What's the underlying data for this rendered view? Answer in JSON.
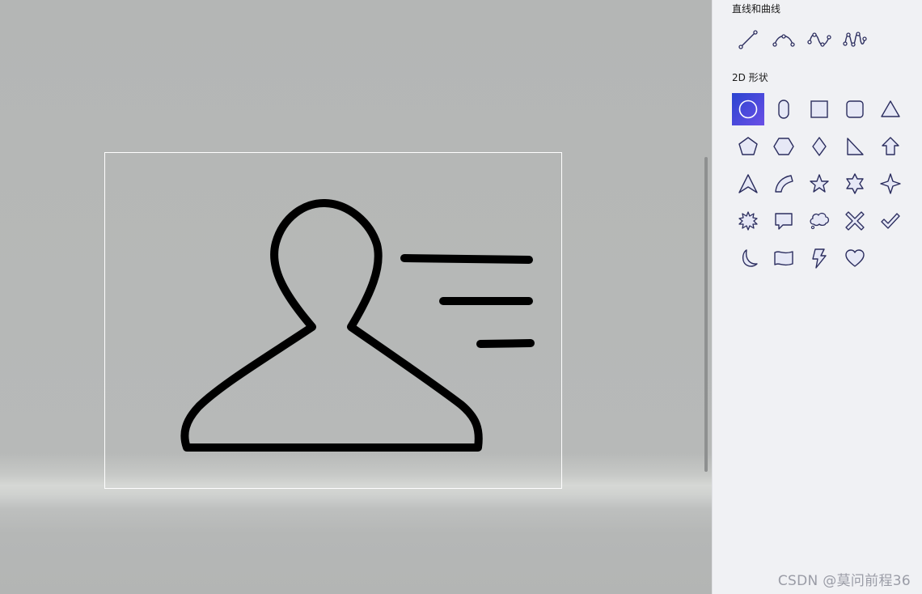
{
  "panel": {
    "lines_section_title": "直线和曲线",
    "shapes_section_title": "2D 形状",
    "line_tools": [
      {
        "icon": "line-icon"
      },
      {
        "icon": "curve-icon"
      },
      {
        "icon": "s-curve-icon"
      },
      {
        "icon": "wave-curve-icon"
      }
    ],
    "shape_tools": [
      {
        "icon": "circle-icon",
        "selected": true
      },
      {
        "icon": "pill-icon"
      },
      {
        "icon": "square-icon"
      },
      {
        "icon": "rounded-square-icon"
      },
      {
        "icon": "triangle-icon"
      },
      {
        "icon": "pentagon-icon"
      },
      {
        "icon": "hexagon-icon"
      },
      {
        "icon": "diamond-icon"
      },
      {
        "icon": "right-triangle-icon"
      },
      {
        "icon": "arrow-up-icon"
      },
      {
        "icon": "arrowhead-icon"
      },
      {
        "icon": "arc-icon"
      },
      {
        "icon": "star-5-icon"
      },
      {
        "icon": "star-6-icon"
      },
      {
        "icon": "star-4-icon"
      },
      {
        "icon": "burst-icon"
      },
      {
        "icon": "speech-bubble-icon"
      },
      {
        "icon": "thought-bubble-icon"
      },
      {
        "icon": "x-mark-icon"
      },
      {
        "icon": "checkmark-icon"
      },
      {
        "icon": "moon-icon"
      },
      {
        "icon": "banner-icon"
      },
      {
        "icon": "lightning-icon"
      },
      {
        "icon": "heart-icon"
      }
    ]
  },
  "watermark": "CSDN @莫问前程36",
  "colors": {
    "icon_stroke": "#2b2d5e",
    "icon_fill": "#e6e8f6",
    "selected_bg_start": "#2a44d0",
    "selected_bg_end": "#6a4fe6",
    "drawing_stroke": "#000000"
  }
}
